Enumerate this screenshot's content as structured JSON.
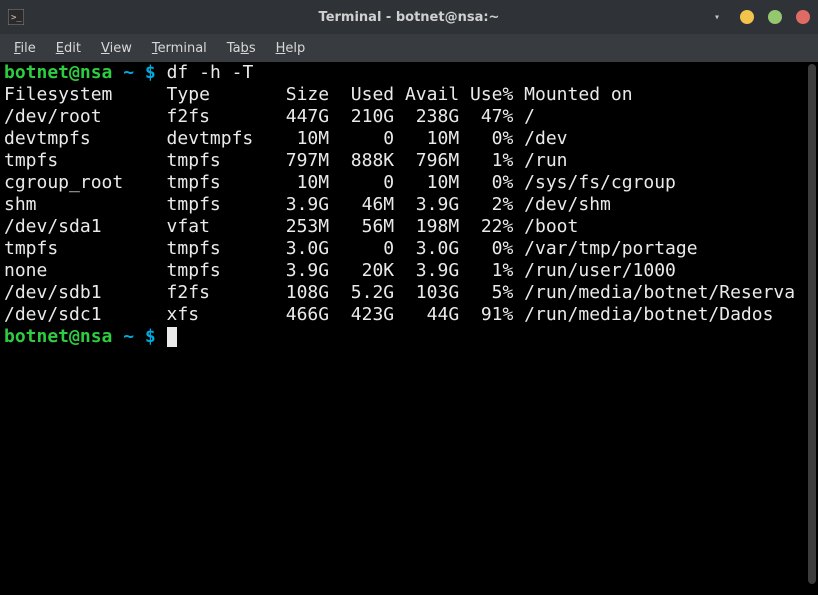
{
  "window": {
    "title": "Terminal - botnet@nsa:~"
  },
  "menu": {
    "items": [
      {
        "ul": "F",
        "rest": "ile"
      },
      {
        "ul": "E",
        "rest": "dit"
      },
      {
        "ul": "V",
        "rest": "iew"
      },
      {
        "ul": "T",
        "rest": "erminal"
      },
      {
        "ul": "",
        "rest": "Ta",
        "ul2": "b",
        "rest2": "s"
      },
      {
        "ul": "H",
        "rest": "elp"
      }
    ]
  },
  "prompt": {
    "user_host": "botnet@nsa",
    "path": "~",
    "dollar": "$"
  },
  "command": "df -h -T",
  "df": {
    "header": {
      "fs": "Filesystem",
      "type": "Type",
      "size": "Size",
      "used": "Used",
      "avail": "Avail",
      "usep": "Use%",
      "mount": "Mounted on"
    },
    "rows": [
      {
        "fs": "/dev/root",
        "type": "f2fs",
        "size": "447G",
        "used": "210G",
        "avail": "238G",
        "usep": "47%",
        "mount": "/"
      },
      {
        "fs": "devtmpfs",
        "type": "devtmpfs",
        "size": "10M",
        "used": "0",
        "avail": "10M",
        "usep": "0%",
        "mount": "/dev"
      },
      {
        "fs": "tmpfs",
        "type": "tmpfs",
        "size": "797M",
        "used": "888K",
        "avail": "796M",
        "usep": "1%",
        "mount": "/run"
      },
      {
        "fs": "cgroup_root",
        "type": "tmpfs",
        "size": "10M",
        "used": "0",
        "avail": "10M",
        "usep": "0%",
        "mount": "/sys/fs/cgroup"
      },
      {
        "fs": "shm",
        "type": "tmpfs",
        "size": "3.9G",
        "used": "46M",
        "avail": "3.9G",
        "usep": "2%",
        "mount": "/dev/shm"
      },
      {
        "fs": "/dev/sda1",
        "type": "vfat",
        "size": "253M",
        "used": "56M",
        "avail": "198M",
        "usep": "22%",
        "mount": "/boot"
      },
      {
        "fs": "tmpfs",
        "type": "tmpfs",
        "size": "3.0G",
        "used": "0",
        "avail": "3.0G",
        "usep": "0%",
        "mount": "/var/tmp/portage"
      },
      {
        "fs": "none",
        "type": "tmpfs",
        "size": "3.9G",
        "used": "20K",
        "avail": "3.9G",
        "usep": "1%",
        "mount": "/run/user/1000"
      },
      {
        "fs": "/dev/sdb1",
        "type": "f2fs",
        "size": "108G",
        "used": "5.2G",
        "avail": "103G",
        "usep": "5%",
        "mount": "/run/media/botnet/Reserva"
      },
      {
        "fs": "/dev/sdc1",
        "type": "xfs",
        "size": "466G",
        "used": "423G",
        "avail": "44G",
        "usep": "91%",
        "mount": "/run/media/botnet/Dados"
      }
    ]
  }
}
